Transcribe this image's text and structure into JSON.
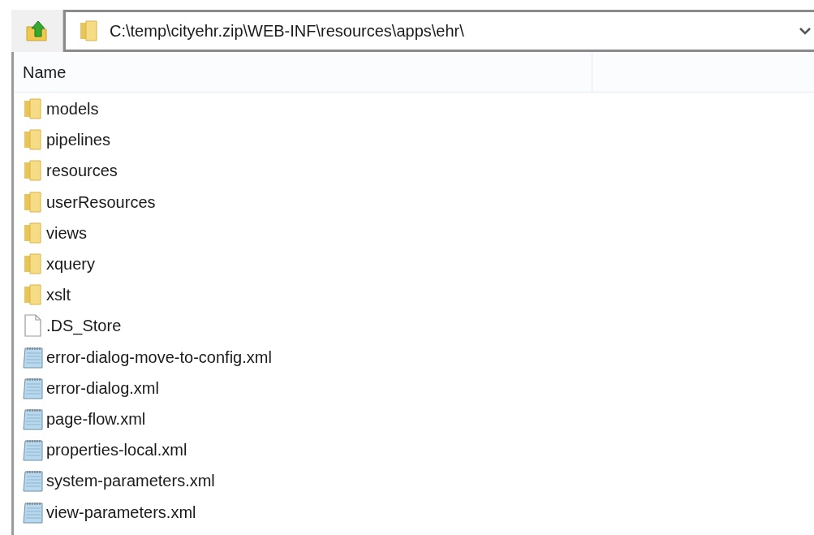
{
  "address": {
    "path": "C:\\temp\\cityehr.zip\\WEB-INF\\resources\\apps\\ehr\\"
  },
  "columns": [
    "Name"
  ],
  "items": [
    {
      "name": "models",
      "kind": "folder"
    },
    {
      "name": "pipelines",
      "kind": "folder"
    },
    {
      "name": "resources",
      "kind": "folder"
    },
    {
      "name": "userResources",
      "kind": "folder"
    },
    {
      "name": "views",
      "kind": "folder"
    },
    {
      "name": "xquery",
      "kind": "folder"
    },
    {
      "name": "xslt",
      "kind": "folder"
    },
    {
      "name": ".DS_Store",
      "kind": "file"
    },
    {
      "name": "error-dialog-move-to-config.xml",
      "kind": "xml"
    },
    {
      "name": "error-dialog.xml",
      "kind": "xml"
    },
    {
      "name": "page-flow.xml",
      "kind": "xml"
    },
    {
      "name": "properties-local.xml",
      "kind": "xml"
    },
    {
      "name": "system-parameters.xml",
      "kind": "xml"
    },
    {
      "name": "view-parameters.xml",
      "kind": "xml"
    }
  ]
}
